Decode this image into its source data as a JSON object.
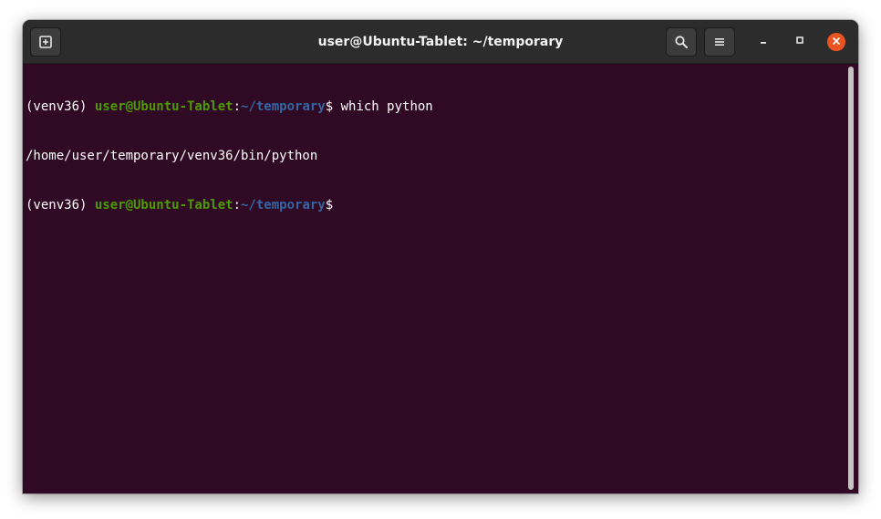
{
  "window": {
    "title": "user@Ubuntu-Tablet: ~/temporary"
  },
  "toolbar": {
    "new_tab_icon": "new-tab-icon",
    "search_icon": "search-icon",
    "menu_icon": "hamburger-menu-icon",
    "minimize_icon": "minimize-icon",
    "maximize_icon": "maximize-icon",
    "close_icon": "close-icon"
  },
  "terminal": {
    "lines": [
      {
        "venv": "(venv36) ",
        "user": "user@Ubuntu-Tablet",
        "colon": ":",
        "path": "~/temporary",
        "dollar": "$ ",
        "command": "which python"
      },
      {
        "output": "/home/user/temporary/venv36/bin/python"
      },
      {
        "venv": "(venv36) ",
        "user": "user@Ubuntu-Tablet",
        "colon": ":",
        "path": "~/temporary",
        "dollar": "$",
        "command": ""
      }
    ]
  },
  "colors": {
    "background": "#300a24",
    "titlebar": "#2c2c2c",
    "prompt_user": "#4e9a06",
    "prompt_path": "#3465a4",
    "close_button": "#e95420"
  }
}
